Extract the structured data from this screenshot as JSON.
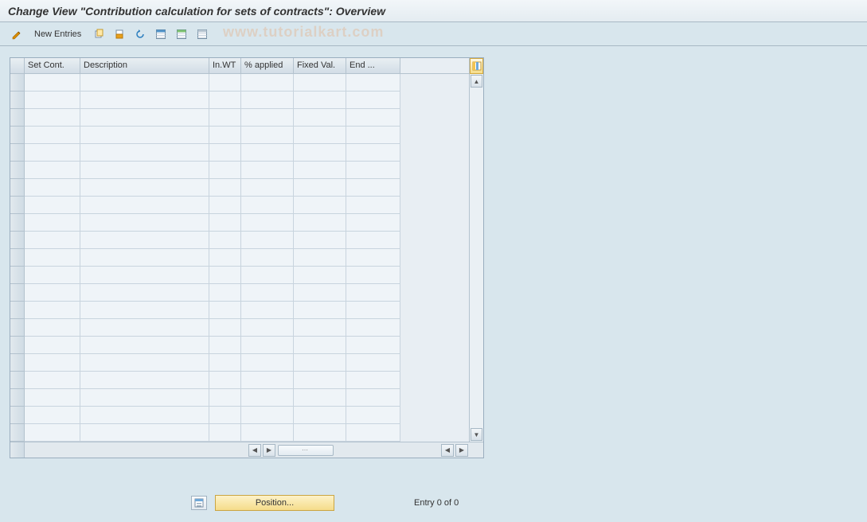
{
  "title": "Change View \"Contribution calculation for sets of contracts\": Overview",
  "toolbar": {
    "new_entries": "New Entries"
  },
  "watermark": "www.tutorialkart.com",
  "grid": {
    "columns": {
      "set_cont": "Set Cont.",
      "description": "Description",
      "in_wt": "In.WT",
      "pct_applied": "% applied",
      "fixed_val": "Fixed Val.",
      "end": "End ..."
    },
    "row_count": 21
  },
  "footer": {
    "position": "Position...",
    "entry": "Entry 0 of 0"
  }
}
